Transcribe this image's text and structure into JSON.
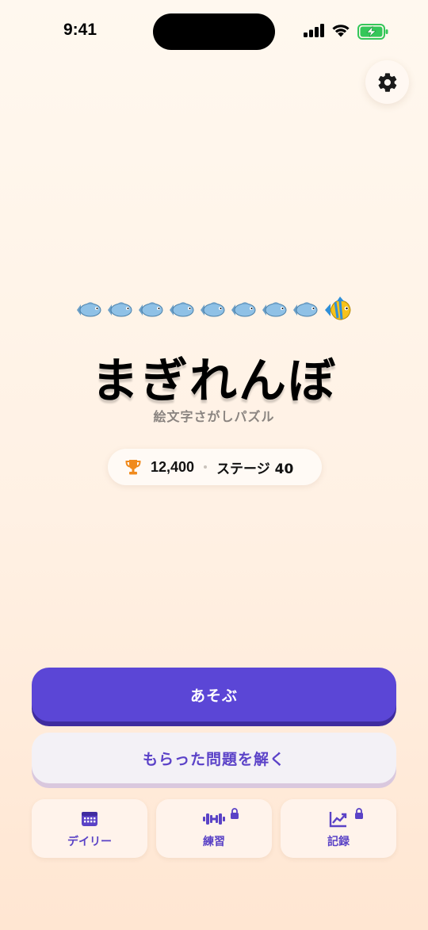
{
  "status_bar": {
    "time": "9:41"
  },
  "icons": {
    "settings": "gear-icon",
    "trophy": "trophy-icon",
    "daily": "calendar-icon",
    "practice": "dumbbell-icon",
    "records": "chart-up-icon",
    "lock": "lock-icon",
    "emoji_row": [
      "fish",
      "fish",
      "fish",
      "fish",
      "fish",
      "fish",
      "fish",
      "fish",
      "tropical-fish"
    ]
  },
  "hero": {
    "title": "まぎれんぼ",
    "subtitle": "絵文字さがしパズル"
  },
  "stats": {
    "score": "12,400",
    "stage": "ステージ 40"
  },
  "actions": {
    "play_label": "あそぶ",
    "solve_label": "もらった問題を解く"
  },
  "tiles": [
    {
      "label": "デイリー",
      "locked": false
    },
    {
      "label": "練習",
      "locked": true
    },
    {
      "label": "記録",
      "locked": true
    }
  ],
  "colors": {
    "primary": "#5b46d6",
    "primary_shadow": "#3f2c9f",
    "secondary_text": "#5b42c8",
    "trophy": "#f08a1c",
    "battery": "#34c759"
  }
}
